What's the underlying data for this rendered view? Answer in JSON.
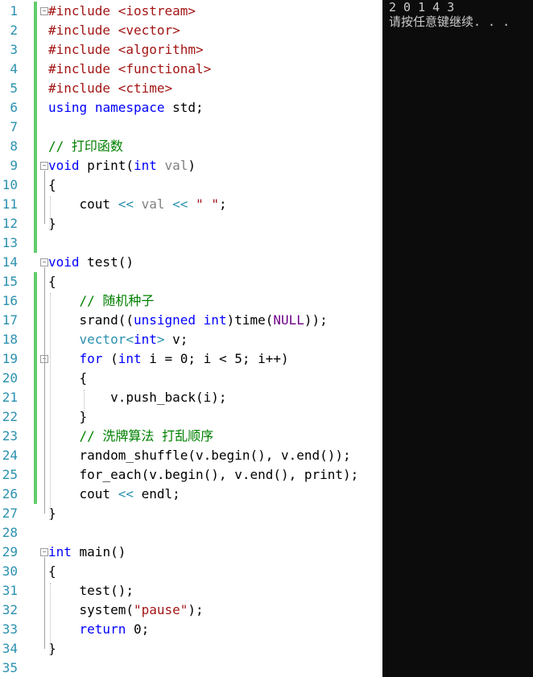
{
  "console": {
    "lines": [
      "2 0 1 4 3",
      "请按任意键继续. . ."
    ]
  },
  "editor": {
    "line_numbers": [
      "1",
      "2",
      "3",
      "4",
      "5",
      "6",
      "7",
      "8",
      "9",
      "10",
      "11",
      "12",
      "13",
      "14",
      "15",
      "16",
      "17",
      "18",
      "19",
      "20",
      "21",
      "22",
      "23",
      "24",
      "25",
      "26",
      "27",
      "28",
      "29",
      "30",
      "31",
      "32",
      "33",
      "34",
      "35"
    ],
    "lines": [
      [
        [
          "p",
          "#include "
        ],
        [
          "s",
          "<iostream>"
        ]
      ],
      [
        [
          "p",
          "#include "
        ],
        [
          "s",
          "<vector>"
        ]
      ],
      [
        [
          "p",
          "#include "
        ],
        [
          "s",
          "<algorithm>"
        ]
      ],
      [
        [
          "p",
          "#include "
        ],
        [
          "s",
          "<functional>"
        ]
      ],
      [
        [
          "p",
          "#include "
        ],
        [
          "s",
          "<ctime>"
        ]
      ],
      [
        [
          "k",
          "using"
        ],
        [
          "n",
          " "
        ],
        [
          "k",
          "namespace"
        ],
        [
          "n",
          " std;"
        ]
      ],
      [],
      [
        [
          "c",
          "// 打印函数"
        ]
      ],
      [
        [
          "k",
          "void"
        ],
        [
          "n",
          " print("
        ],
        [
          "k",
          "int"
        ],
        [
          "n",
          " "
        ],
        [
          "g",
          "val"
        ],
        [
          "n",
          ")"
        ]
      ],
      [
        [
          "n",
          "{"
        ]
      ],
      [
        [
          "n",
          "    cout "
        ],
        [
          "t",
          "<<"
        ],
        [
          "n",
          " "
        ],
        [
          "g",
          "val"
        ],
        [
          "n",
          " "
        ],
        [
          "t",
          "<<"
        ],
        [
          "n",
          " "
        ],
        [
          "s",
          "\" \""
        ],
        [
          "n",
          ";"
        ]
      ],
      [
        [
          "n",
          "}"
        ]
      ],
      [],
      [
        [
          "k",
          "void"
        ],
        [
          "n",
          " test()"
        ]
      ],
      [
        [
          "n",
          "{"
        ]
      ],
      [
        [
          "n",
          "    "
        ],
        [
          "c",
          "// 随机种子"
        ]
      ],
      [
        [
          "n",
          "    srand(("
        ],
        [
          "k",
          "unsigned"
        ],
        [
          "n",
          " "
        ],
        [
          "k",
          "int"
        ],
        [
          "n",
          ")time("
        ],
        [
          "m",
          "NULL"
        ],
        [
          "n",
          "));"
        ]
      ],
      [
        [
          "n",
          "    "
        ],
        [
          "t",
          "vector"
        ],
        [
          "t",
          "<"
        ],
        [
          "k",
          "int"
        ],
        [
          "t",
          ">"
        ],
        [
          "n",
          " v;"
        ]
      ],
      [
        [
          "n",
          "    "
        ],
        [
          "k",
          "for"
        ],
        [
          "n",
          " ("
        ],
        [
          "k",
          "int"
        ],
        [
          "n",
          " i = 0; i < 5; i++)"
        ]
      ],
      [
        [
          "n",
          "    {"
        ]
      ],
      [
        [
          "n",
          "        v.push_back(i);"
        ]
      ],
      [
        [
          "n",
          "    }"
        ]
      ],
      [
        [
          "n",
          "    "
        ],
        [
          "c",
          "// 洗牌算法 打乱顺序"
        ]
      ],
      [
        [
          "n",
          "    random_shuffle(v.begin(), v.end());"
        ]
      ],
      [
        [
          "n",
          "    for_each(v.begin(), v.end(), print);"
        ]
      ],
      [
        [
          "n",
          "    cout "
        ],
        [
          "t",
          "<<"
        ],
        [
          "n",
          " endl;"
        ]
      ],
      [
        [
          "n",
          "}"
        ]
      ],
      [],
      [
        [
          "k",
          "int"
        ],
        [
          "n",
          " main()"
        ]
      ],
      [
        [
          "n",
          "{"
        ]
      ],
      [
        [
          "n",
          "    test();"
        ]
      ],
      [
        [
          "n",
          "    system("
        ],
        [
          "s",
          "\"pause\""
        ],
        [
          "n",
          ");"
        ]
      ],
      [
        [
          "n",
          "    "
        ],
        [
          "k",
          "return"
        ],
        [
          "n",
          " 0;"
        ]
      ],
      [
        [
          "n",
          "}"
        ]
      ],
      []
    ]
  }
}
